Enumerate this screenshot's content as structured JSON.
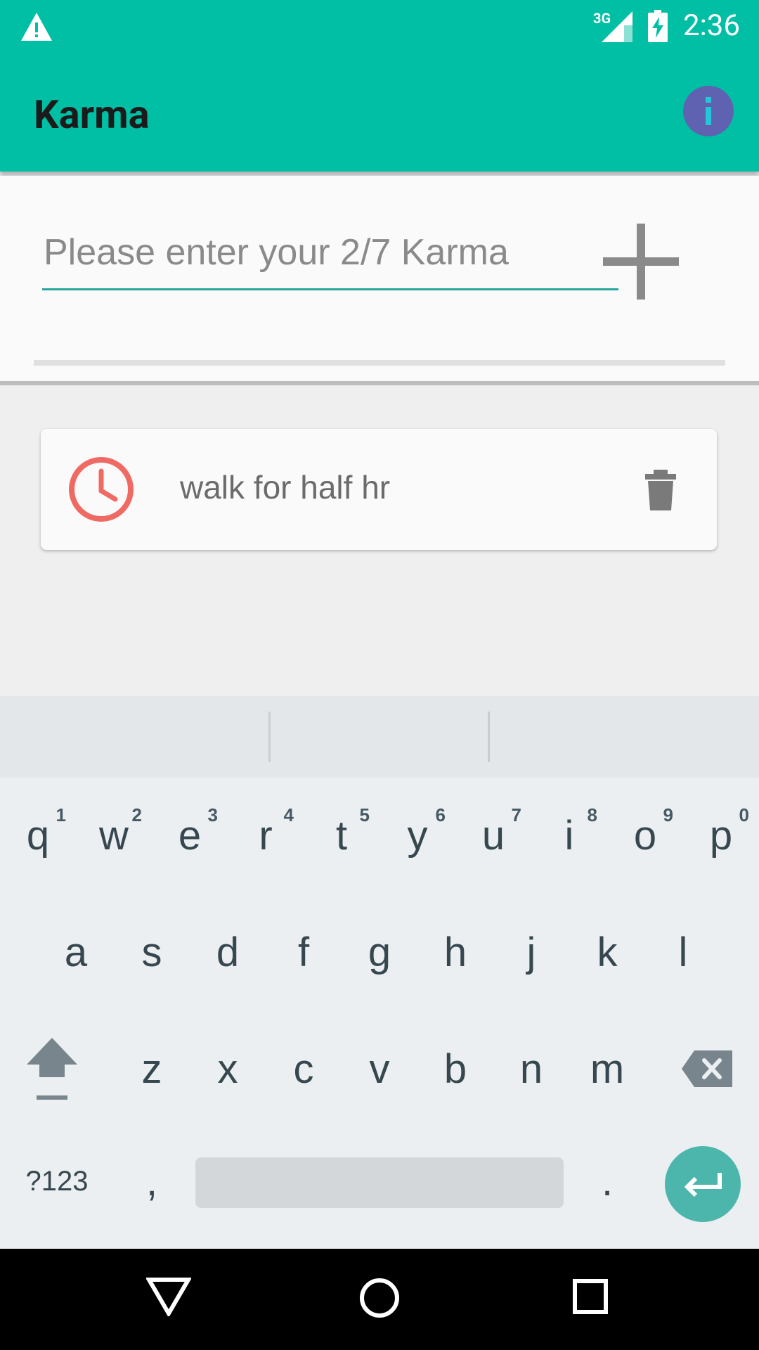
{
  "status_bar": {
    "network": "3G",
    "time": "2:36"
  },
  "app_bar": {
    "title": "Karma"
  },
  "input": {
    "placeholder": "Please enter your 2/7 Karma",
    "value": ""
  },
  "list": {
    "items": [
      {
        "text": "walk for half hr"
      }
    ]
  },
  "keyboard": {
    "row1": [
      {
        "key": "q",
        "hint": "1"
      },
      {
        "key": "w",
        "hint": "2"
      },
      {
        "key": "e",
        "hint": "3"
      },
      {
        "key": "r",
        "hint": "4"
      },
      {
        "key": "t",
        "hint": "5"
      },
      {
        "key": "y",
        "hint": "6"
      },
      {
        "key": "u",
        "hint": "7"
      },
      {
        "key": "i",
        "hint": "8"
      },
      {
        "key": "o",
        "hint": "9"
      },
      {
        "key": "p",
        "hint": "0"
      }
    ],
    "row2": [
      "a",
      "s",
      "d",
      "f",
      "g",
      "h",
      "j",
      "k",
      "l"
    ],
    "row3": [
      "z",
      "x",
      "c",
      "v",
      "b",
      "n",
      "m"
    ],
    "symbols_label": "?123",
    "comma": ",",
    "period": "."
  },
  "colors": {
    "primary": "#00bfa5",
    "accent": "#26a69a",
    "info": "#5f62b0",
    "clock_icon": "#f06a64"
  }
}
